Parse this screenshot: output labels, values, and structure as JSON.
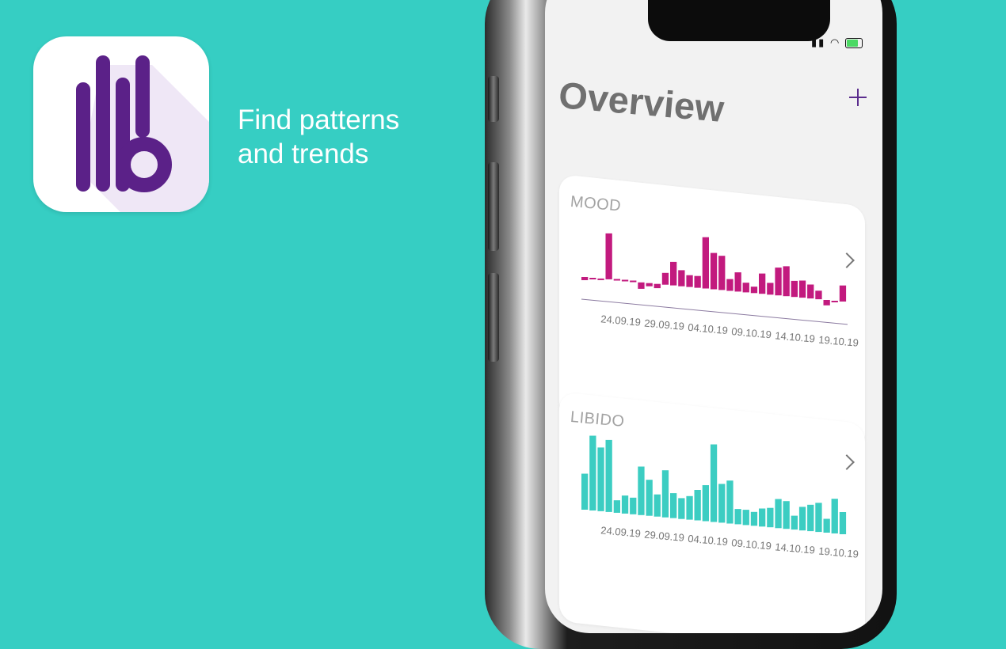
{
  "promo": {
    "tagline_line1": "Find patterns",
    "tagline_line2": "and trends"
  },
  "colors": {
    "background": "#36cec3",
    "brand_purple": "#5b2d8e",
    "mood_bar": "#c21a7e",
    "libido_bar": "#3ccdc2"
  },
  "screen": {
    "title": "Overview",
    "add_icon": "plus-icon"
  },
  "mood_card": {
    "title": "MOOD",
    "chevron_icon": "chevron-right-icon"
  },
  "libido_card": {
    "title": "LIBIDO",
    "chevron_icon": "chevron-right-icon"
  },
  "chart_data": [
    {
      "type": "bar",
      "title": "MOOD",
      "tick_labels": [
        "24.09.19",
        "29.09.19",
        "04.10.19",
        "09.10.19",
        "14.10.19",
        "19.10.19"
      ],
      "baseline": 0,
      "ylim": [
        -1,
        6
      ],
      "values": [
        -0.3,
        0,
        0,
        4.3,
        0.1,
        0.1,
        0.1,
        -0.6,
        -0.3,
        -0.4,
        1.1,
        2.2,
        1.5,
        1.1,
        1.1,
        4.8,
        3.4,
        3.2,
        1.1,
        1.8,
        0.9,
        0.6,
        1.9,
        1.1,
        2.6,
        2.8,
        1.5,
        1.6,
        1.3,
        0.8,
        -0.5,
        -0.1,
        1.5
      ],
      "color": "#c21a7e"
    },
    {
      "type": "bar",
      "title": "LIBIDO",
      "tick_labels": [
        "24.09.19",
        "29.09.19",
        "04.10.19",
        "09.10.19",
        "14.10.19",
        "19.10.19"
      ],
      "ylim": [
        0,
        7
      ],
      "values": [
        2.6,
        5.4,
        4.6,
        5.2,
        0.9,
        1.3,
        1.2,
        3.5,
        2.6,
        1.6,
        3.4,
        1.8,
        1.5,
        1.7,
        2.2,
        2.6,
        5.6,
        2.8,
        3.1,
        1.1,
        1.1,
        1.0,
        1.3,
        1.4,
        2.1,
        2.0,
        1.0,
        1.7,
        1.9,
        2.1,
        1.0,
        2.5,
        1.6
      ],
      "color": "#3ccdc2"
    }
  ]
}
